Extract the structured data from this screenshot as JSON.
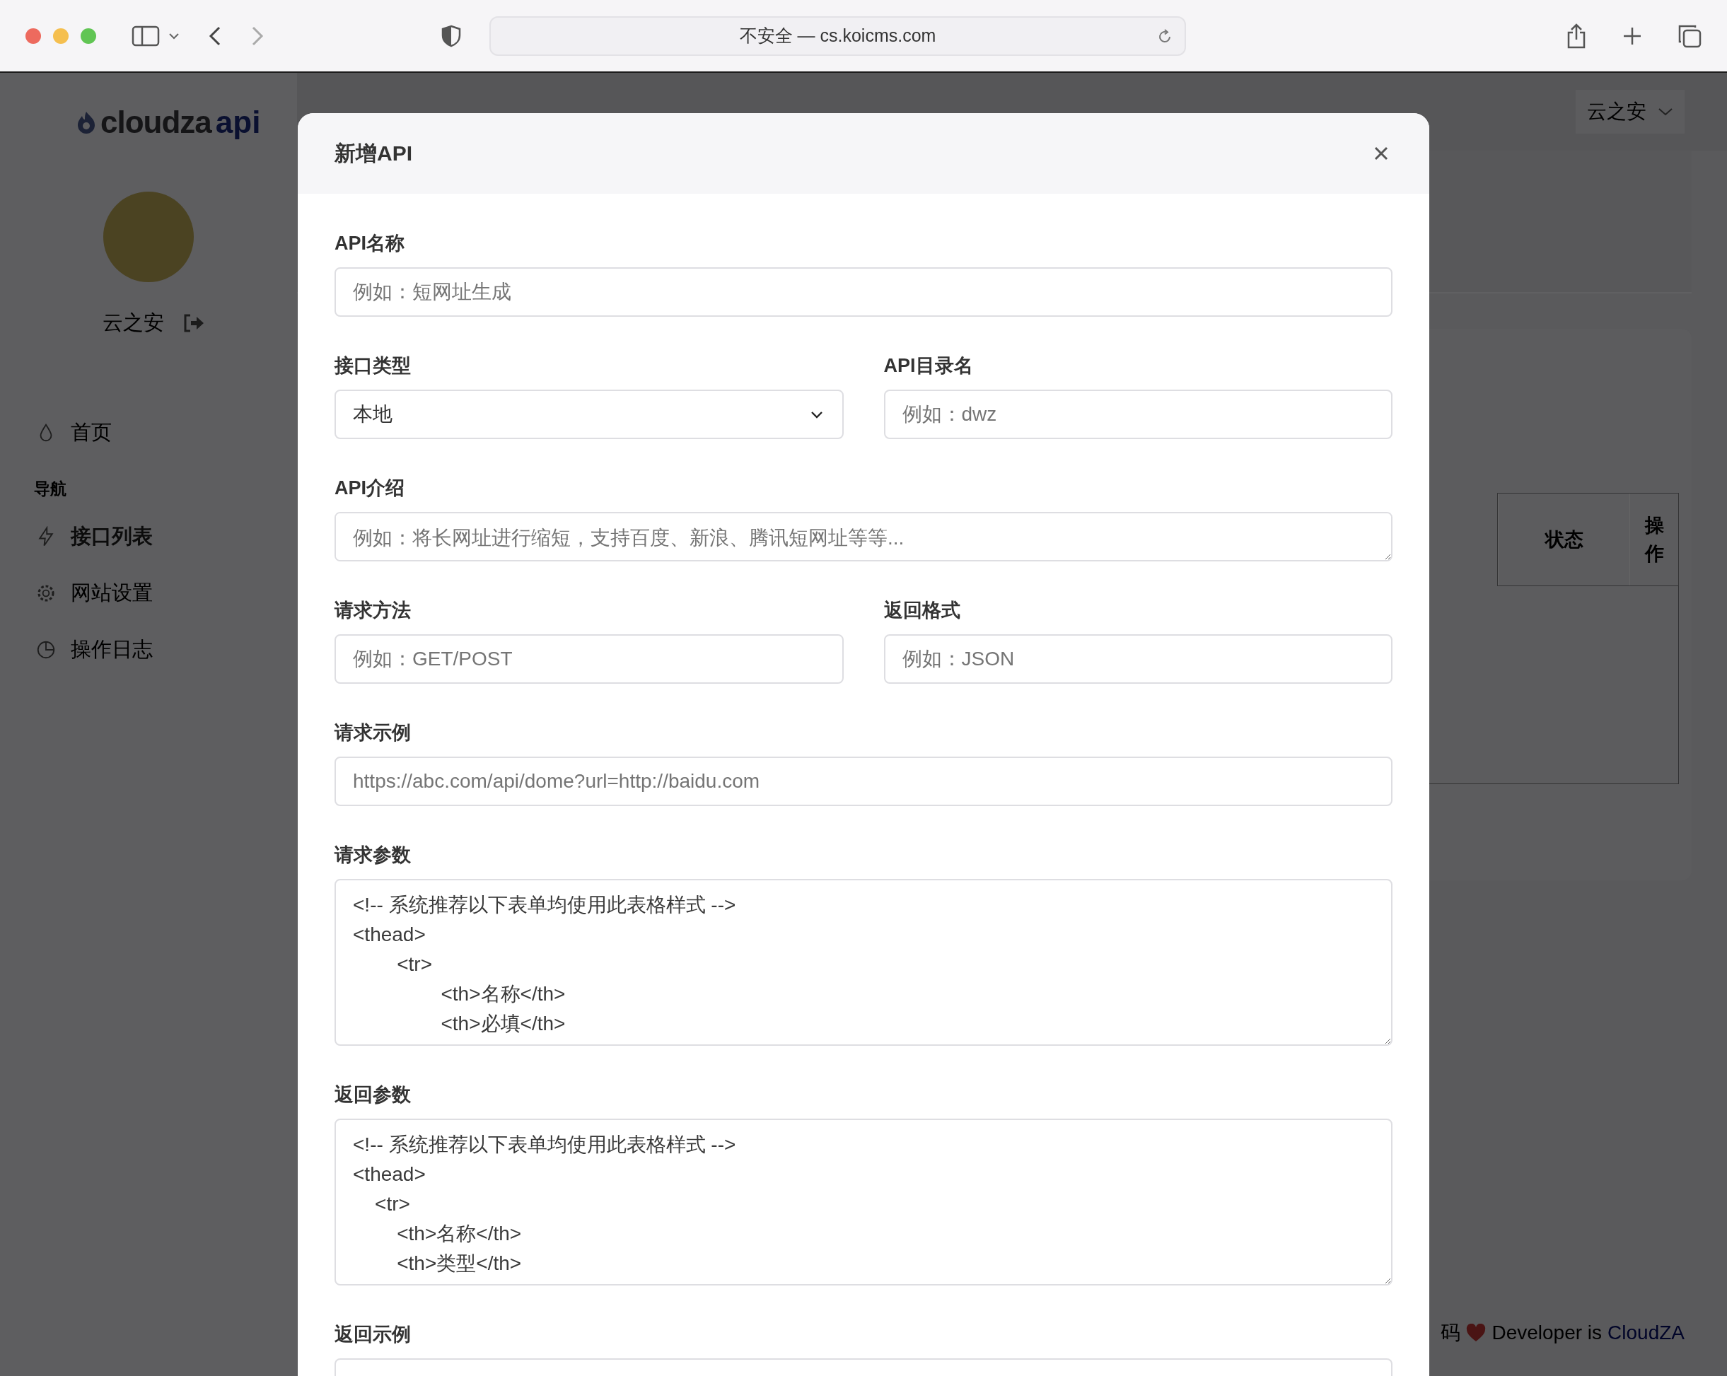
{
  "browser": {
    "address": "不安全 — cs.koicms.com"
  },
  "app": {
    "logo": {
      "name": "cloudza",
      "suffix": "api"
    },
    "user_menu": "云之安",
    "profile": {
      "name": "云之安"
    },
    "nav": [
      {
        "kind": "item",
        "label": "首页",
        "selected": false
      },
      {
        "kind": "section",
        "label": "导航"
      },
      {
        "kind": "item",
        "label": "接口列表",
        "selected": true
      },
      {
        "kind": "item",
        "label": "网站设置",
        "selected": false
      },
      {
        "kind": "item",
        "label": "操作日志",
        "selected": false
      }
    ],
    "table": {
      "columns": [
        "状态",
        "操作"
      ]
    },
    "footer": {
      "prefix": "码",
      "text": "Developer is",
      "link": "CloudZA"
    }
  },
  "modal": {
    "title": "新增API",
    "rows": [
      [
        {
          "kind": "input",
          "label": "API名称",
          "placeholder": "例如：短网址生成"
        }
      ],
      [
        {
          "kind": "select",
          "label": "接口类型",
          "value": "本地"
        },
        {
          "kind": "input",
          "label": "API目录名",
          "placeholder": "例如：dwz"
        }
      ],
      [
        {
          "kind": "textarea",
          "label": "API介绍",
          "placeholder": "例如：将长网址进行缩短，支持百度、新浪、腾讯短网址等等..."
        }
      ],
      [
        {
          "kind": "input",
          "label": "请求方法",
          "placeholder": "例如：GET/POST"
        },
        {
          "kind": "input",
          "label": "返回格式",
          "placeholder": "例如：JSON"
        }
      ],
      [
        {
          "kind": "input",
          "label": "请求示例",
          "placeholder": "https://abc.com/api/dome?url=http://baidu.com"
        }
      ],
      [
        {
          "kind": "code",
          "label": "请求参数",
          "value": "<!-- 系统推荐以下表单均使用此表格样式 -->\n<thead>\n        <tr>\n                <th>名称</th>\n                <th>必填</th>"
        }
      ],
      [
        {
          "kind": "code",
          "label": "返回参数",
          "value": "<!-- 系统推荐以下表单均使用此表格样式 -->\n<thead>\n    <tr>\n        <th>名称</th>\n        <th>类型</th>"
        }
      ],
      [
        {
          "kind": "stub",
          "label": "返回示例"
        }
      ]
    ]
  }
}
